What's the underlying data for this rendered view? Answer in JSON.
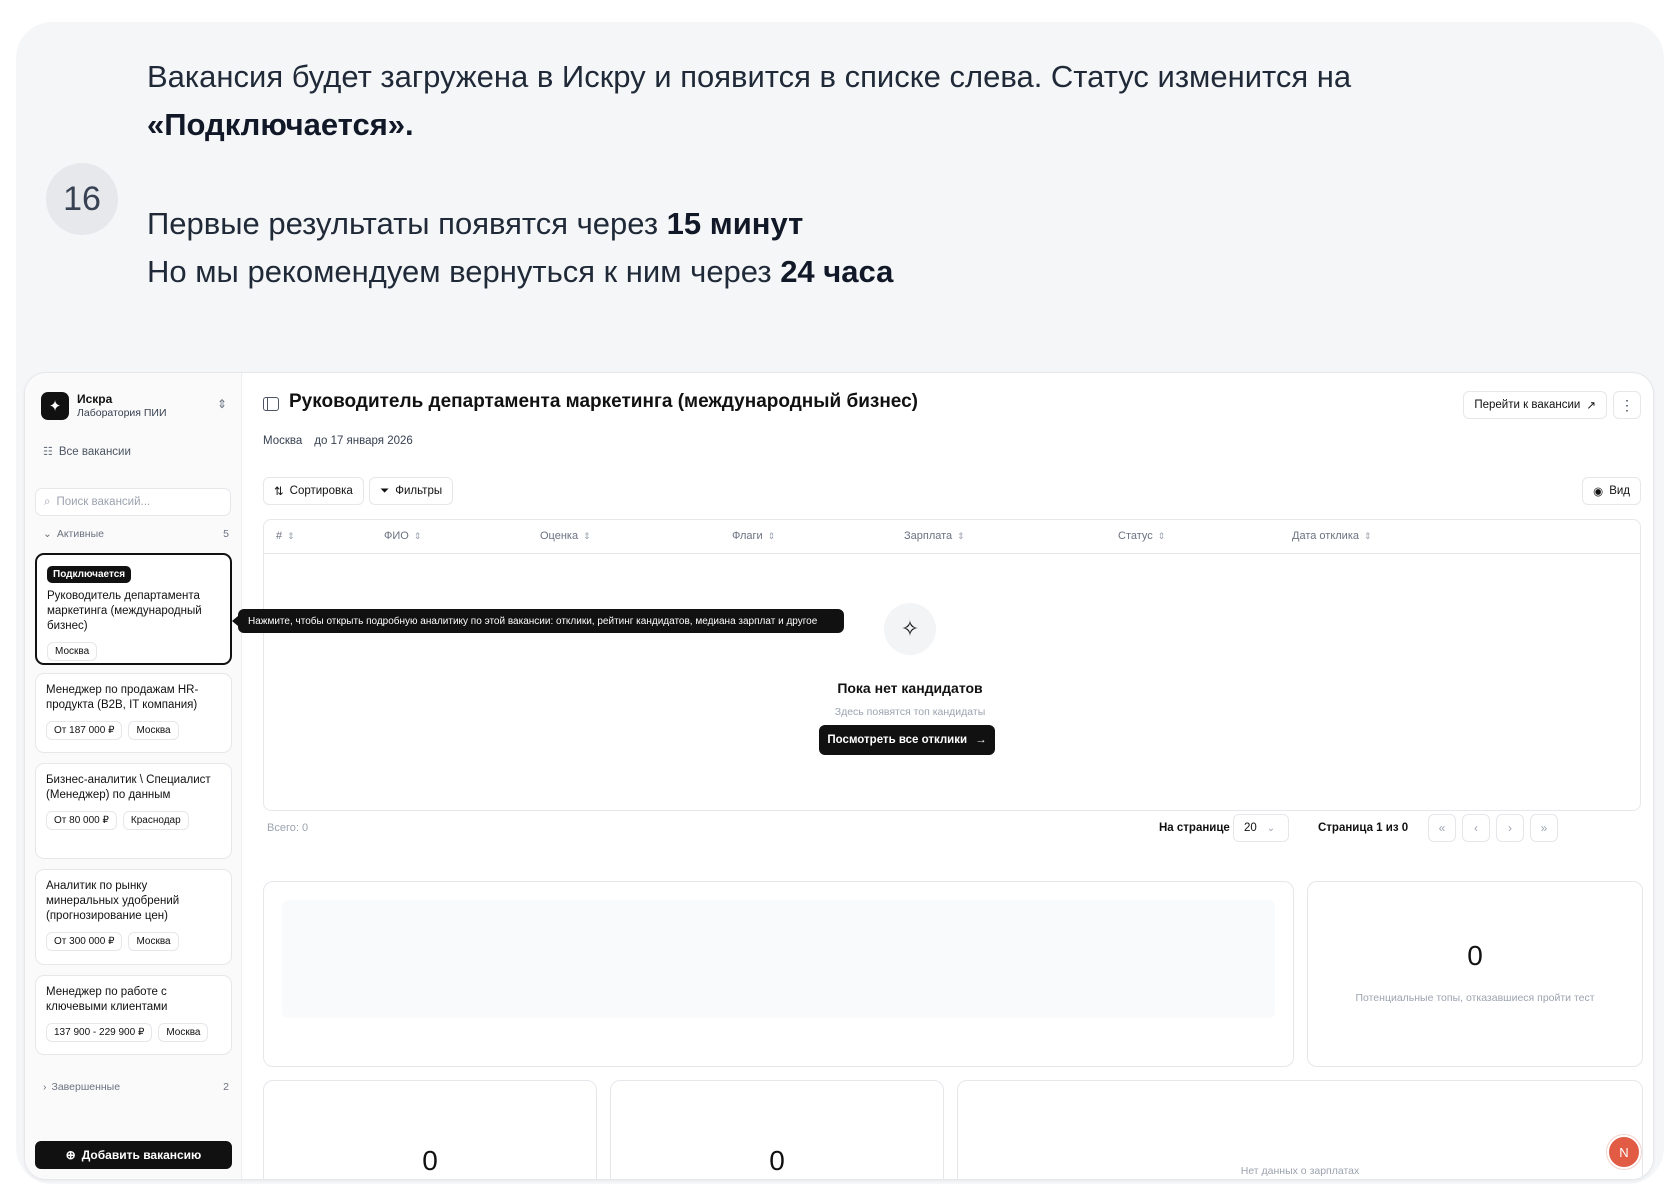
{
  "step": {
    "number": "16"
  },
  "instructions": {
    "line1_text": "Вакансия будет загружена в Искру и появится в списке слева. Статус изменится на ",
    "line1_bold": "«Подключается».",
    "line2_text": "Первые результаты появятся через ",
    "line2_bold": "15 минут",
    "line3_text": "Но мы рекомендуем вернуться к ним через ",
    "line3_bold": "24 часа"
  },
  "sidebar": {
    "brand_name": "Искра",
    "brand_sub": "Лаборатория ПИИ",
    "all_vacancies": "Все вакансии",
    "search_placeholder": "Поиск вакансий...",
    "active_group": {
      "label": "Активные",
      "count": "5"
    },
    "finished_group": {
      "label": "Завершенные",
      "count": "2"
    },
    "vacancies": [
      {
        "status": "Подключается",
        "title": "Руководитель департамента маркетинга (международный бизнес)",
        "tags": [
          "Москва"
        ]
      },
      {
        "title": "Менеджер по продажам HR-продукта (B2B, IT компания)",
        "tags": [
          "От 187 000 ₽",
          "Москва"
        ]
      },
      {
        "title": "Бизнес-аналитик \\ Специалист (Менеджер) по данным",
        "tags": [
          "От 80 000 ₽",
          "Краснодар"
        ]
      },
      {
        "title": "Аналитик по рынку минеральных удобрений (прогнозирование цен)",
        "tags": [
          "От 300 000 ₽",
          "Москва"
        ]
      },
      {
        "title": "Менеджер по работе с ключевыми клиентами",
        "tags": [
          "137 900 - 229 900 ₽",
          "Москва"
        ]
      }
    ],
    "add_button": "Добавить вакансию",
    "tooltip": "Нажмите, чтобы открыть подробную аналитику по этой вакансии: отклики, рейтинг кандидатов, медиана зарплат и другое"
  },
  "main": {
    "title": "Руководитель департамента маркетинга (международный бизнес)",
    "city": "Москва",
    "deadline": "до 17 января 2026",
    "go_button": "Перейти к вакансии",
    "sort_button": "Сортировка",
    "filter_button": "Фильтры",
    "view_button": "Вид",
    "columns": [
      "#",
      "ФИО",
      "Оценка",
      "Флаги",
      "Зарплата",
      "Статус",
      "Дата отклика"
    ],
    "empty_title": "Пока нет кандидатов",
    "empty_sub": "Здесь появятся топ кандидаты",
    "empty_button": "Посмотреть все отклики",
    "total": "Всего: 0",
    "per_page_label": "На странице",
    "per_page_value": "20",
    "page_info": "Страница 1 из 0",
    "stat_right_value": "0",
    "stat_right_note": "Потенциальные топы, отказавшиеся пройти тест",
    "stat_a_value": "0",
    "stat_b_value": "0",
    "salary_note": "Нет данных о зарплатах",
    "avatar_letter": "N"
  }
}
